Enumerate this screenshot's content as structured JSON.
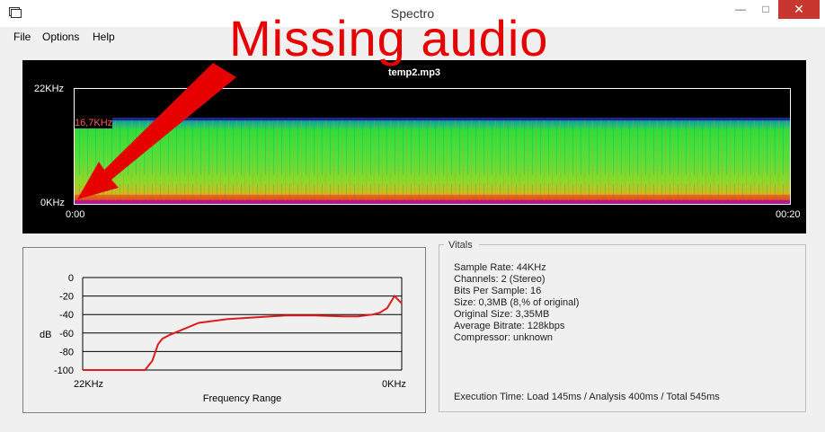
{
  "window": {
    "title": "Spectro"
  },
  "menu": {
    "items": [
      "File",
      "Options",
      "Help"
    ]
  },
  "spectrogram": {
    "file": "temp2.mp3",
    "y_top": "22KHz",
    "y_bottom": "0KHz",
    "cutoff": "16,7KHz",
    "x_start": "0:00",
    "x_end": "00:20"
  },
  "graph": {
    "ylabel": "dB",
    "xlabel": "Frequency Range",
    "x_left": "22KHz",
    "x_right": "0KHz",
    "yticks": [
      "0",
      "-20",
      "-40",
      "-60",
      "-80",
      "-100"
    ]
  },
  "chart_data": {
    "type": "line",
    "xlabel": "Frequency Range",
    "ylabel": "dB",
    "ylim": [
      -100,
      0
    ],
    "x_labels": [
      "22KHz",
      "0KHz"
    ],
    "grid": true,
    "series": [
      {
        "x": [
          22,
          17.7,
          17.2,
          16.8,
          16.5,
          16,
          14,
          12,
          10,
          8,
          6,
          4,
          3,
          2,
          1.5,
          1,
          0.5,
          0
        ],
        "y": [
          -100,
          -100,
          -90,
          -72,
          -66,
          -62,
          -49,
          -45,
          -43,
          -41,
          -41,
          -42,
          -42,
          -40,
          -38,
          -33,
          -20,
          -28
        ]
      }
    ]
  },
  "vitals": {
    "title": "Vitals",
    "lines": [
      "Sample Rate: 44KHz",
      "Channels: 2 (Stereo)",
      "Bits Per Sample: 16",
      "Size: 0,3MB (8,% of original)",
      "Original Size: 3,35MB",
      "Average Bitrate: 128kbps",
      "Compressor: unknown"
    ],
    "exec": "Execution Time: Load 145ms / Analysis 400ms / Total 545ms"
  },
  "annotation": {
    "text": "Missing audio"
  },
  "colors": {
    "arrow": "#e60000",
    "curve": "#e01b1b",
    "spectro_bg": "#000000"
  }
}
